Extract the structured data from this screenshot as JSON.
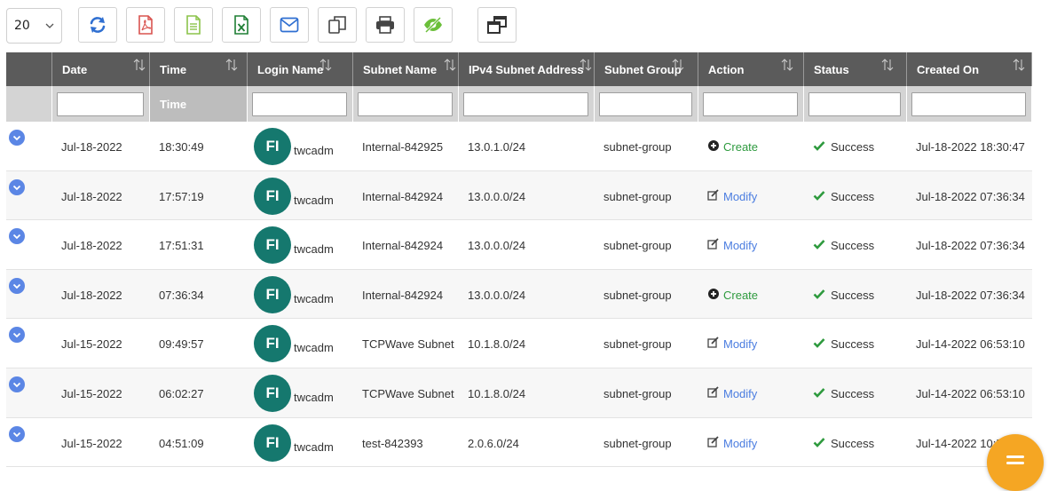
{
  "toolbar": {
    "page_size": "20",
    "buttons": [
      {
        "name": "refresh-button",
        "icon": "refresh-icon",
        "color": "#2f6fd1"
      },
      {
        "name": "export-pdf-button",
        "icon": "pdf-file-icon",
        "color": "#d9534f"
      },
      {
        "name": "export-csv-button",
        "icon": "text-file-icon",
        "color": "#8bc34a"
      },
      {
        "name": "export-excel-button",
        "icon": "excel-file-icon",
        "color": "#1e7e34"
      },
      {
        "name": "email-button",
        "icon": "envelope-icon",
        "color": "#2f6fd1"
      },
      {
        "name": "copy-button",
        "icon": "copy-icon",
        "color": "#444444"
      },
      {
        "name": "print-button",
        "icon": "printer-icon",
        "color": "#444444"
      },
      {
        "name": "toggle-visibility-button",
        "icon": "eye-slash-icon",
        "color": "#6bbf3a"
      },
      {
        "name": "columns-button",
        "icon": "window-restore-icon",
        "color": "#333333"
      }
    ]
  },
  "table": {
    "columns": [
      "",
      "Date",
      "Time",
      "Login Name",
      "Subnet Name",
      "IPv4 Subnet Address",
      "Subnet Group",
      "Action",
      "Status",
      "Created On"
    ],
    "filter_time_label": "Time",
    "rows": [
      {
        "date": "Jul-18-2022",
        "time": "18:30:49",
        "avatar": "FI",
        "login": "twcadm",
        "subnet": "Internal-842925",
        "ipv4": "13.0.1.0/24",
        "group": "subnet-group",
        "action": "Create",
        "status": "Success",
        "created": "Jul-18-2022 18:30:47"
      },
      {
        "date": "Jul-18-2022",
        "time": "17:57:19",
        "avatar": "FI",
        "login": "twcadm",
        "subnet": "Internal-842924",
        "ipv4": "13.0.0.0/24",
        "group": "subnet-group",
        "action": "Modify",
        "status": "Success",
        "created": "Jul-18-2022 07:36:34"
      },
      {
        "date": "Jul-18-2022",
        "time": "17:51:31",
        "avatar": "FI",
        "login": "twcadm",
        "subnet": "Internal-842924",
        "ipv4": "13.0.0.0/24",
        "group": "subnet-group",
        "action": "Modify",
        "status": "Success",
        "created": "Jul-18-2022 07:36:34"
      },
      {
        "date": "Jul-18-2022",
        "time": "07:36:34",
        "avatar": "FI",
        "login": "twcadm",
        "subnet": "Internal-842924",
        "ipv4": "13.0.0.0/24",
        "group": "subnet-group",
        "action": "Create",
        "status": "Success",
        "created": "Jul-18-2022 07:36:34"
      },
      {
        "date": "Jul-15-2022",
        "time": "09:49:57",
        "avatar": "FI",
        "login": "twcadm",
        "subnet": "TCPWave Subnet",
        "ipv4": "10.1.8.0/24",
        "group": "subnet-group",
        "action": "Modify",
        "status": "Success",
        "created": "Jul-14-2022 06:53:10"
      },
      {
        "date": "Jul-15-2022",
        "time": "06:02:27",
        "avatar": "FI",
        "login": "twcadm",
        "subnet": "TCPWave Subnet",
        "ipv4": "10.1.8.0/24",
        "group": "subnet-group",
        "action": "Modify",
        "status": "Success",
        "created": "Jul-14-2022 06:53:10"
      },
      {
        "date": "Jul-15-2022",
        "time": "04:51:09",
        "avatar": "FI",
        "login": "twcadm",
        "subnet": "test-842393",
        "ipv4": "2.0.6.0/24",
        "group": "subnet-group",
        "action": "Modify",
        "status": "Success",
        "created": "Jul-14-2022 10:5"
      }
    ]
  },
  "colors": {
    "header_bg": "#5b5b5b",
    "filter_bg": "#d4d4d4",
    "avatar_bg": "#15786e",
    "expand_btn": "#5b86e5",
    "create_color": "#2e9a3e",
    "modify_color": "#4b7de0",
    "success_check": "#2e9a3e",
    "fab_bg": "#f5a623"
  }
}
